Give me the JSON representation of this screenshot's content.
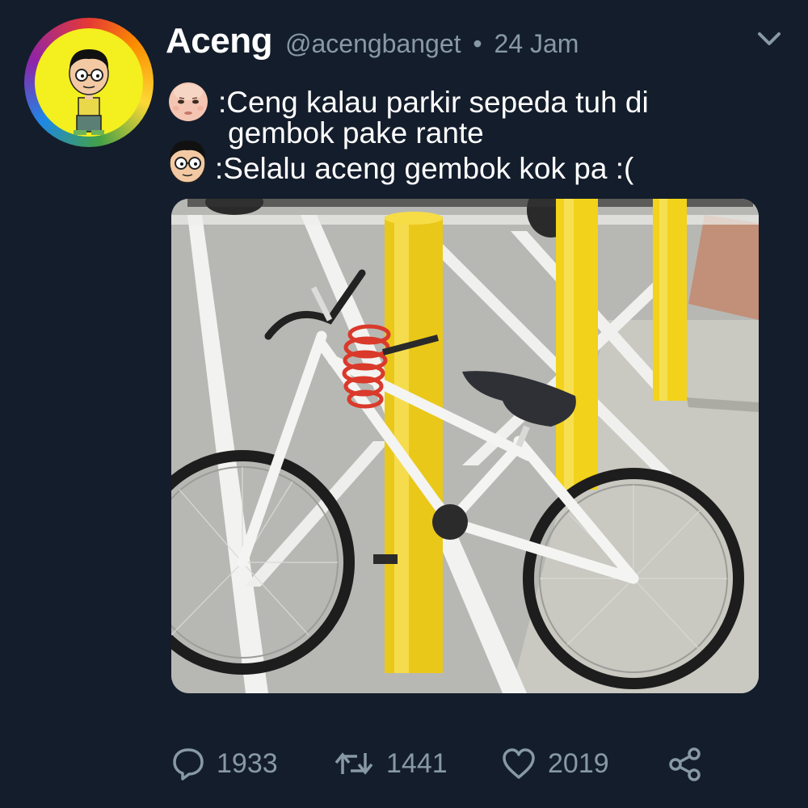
{
  "tweet": {
    "display_name": "Aceng",
    "handle": "@acengbanget",
    "separator": "•",
    "time": "24 Jam",
    "lines": [
      ":Ceng kalau parkir sepeda tuh di",
      "gembok pake rante",
      ":Selalu aceng gembok kok pa :("
    ],
    "speaker_icons": [
      "baby-face-emoji-icon",
      "aceng-face-emoji-icon"
    ],
    "image_subject": "white bicycle with red coil lock wrapped around yellow bollard, not attached to bike"
  },
  "actions": {
    "reply_count": "1933",
    "retweet_count": "1441",
    "like_count": "2019"
  },
  "colors": {
    "background": "#141d2b",
    "muted_text": "#8899a6",
    "bollard": "#f2d21b",
    "lock": "#d93a2b"
  }
}
